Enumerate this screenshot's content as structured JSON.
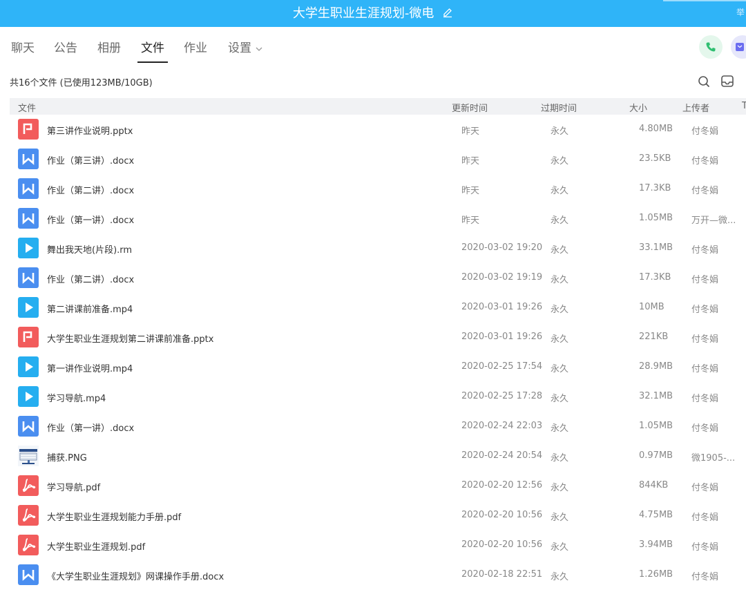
{
  "window": {
    "title": "大学生职业生涯规划-微电",
    "corner_text": "举"
  },
  "tabs": [
    {
      "label": "聊天"
    },
    {
      "label": "公告"
    },
    {
      "label": "相册"
    },
    {
      "label": "文件",
      "active": true
    },
    {
      "label": "作业"
    },
    {
      "label": "设置"
    }
  ],
  "summary": "共16个文件 (已使用123MB/10GB)",
  "table": {
    "headers": {
      "file": "文件",
      "updated": "更新时间",
      "expire": "过期时间",
      "size": "大小",
      "uploader": "上传者",
      "extra": "T"
    },
    "rows": [
      {
        "icon": "ppt-icon",
        "name": "第三讲作业说明.pptx",
        "updated": "昨天",
        "expire": "永久",
        "size": "4.80MB",
        "uploader": "付冬娟"
      },
      {
        "icon": "word-icon",
        "name": "作业（第三讲）.docx",
        "updated": "昨天",
        "expire": "永久",
        "size": "23.5KB",
        "uploader": "付冬娟"
      },
      {
        "icon": "word-icon",
        "name": "作业（第二讲）.docx",
        "updated": "昨天",
        "expire": "永久",
        "size": "17.3KB",
        "uploader": "付冬娟"
      },
      {
        "icon": "word-icon",
        "name": "作业（第一讲）.docx",
        "updated": "昨天",
        "expire": "永久",
        "size": "1.05MB",
        "uploader": "万开—微..."
      },
      {
        "icon": "video-icon",
        "name": "舞出我天地(片段).rm",
        "updated": "2020-03-02 19:20",
        "expire": "永久",
        "size": "33.1MB",
        "uploader": "付冬娟"
      },
      {
        "icon": "word-icon",
        "name": "作业（第二讲）.docx",
        "updated": "2020-03-02 19:19",
        "expire": "永久",
        "size": "17.3KB",
        "uploader": "付冬娟"
      },
      {
        "icon": "video-icon",
        "name": "第二讲课前准备.mp4",
        "updated": "2020-03-01 19:26",
        "expire": "永久",
        "size": "10MB",
        "uploader": "付冬娟"
      },
      {
        "icon": "ppt-icon",
        "name": "大学生职业生涯规划第二讲课前准备.pptx",
        "updated": "2020-03-01 19:26",
        "expire": "永久",
        "size": "221KB",
        "uploader": "付冬娟"
      },
      {
        "icon": "video-icon",
        "name": "第一讲作业说明.mp4",
        "updated": "2020-02-25 17:54",
        "expire": "永久",
        "size": "28.9MB",
        "uploader": "付冬娟"
      },
      {
        "icon": "video-icon",
        "name": "学习导航.mp4",
        "updated": "2020-02-25 17:28",
        "expire": "永久",
        "size": "32.1MB",
        "uploader": "付冬娟"
      },
      {
        "icon": "word-icon",
        "name": "作业（第一讲）.docx",
        "updated": "2020-02-24 22:03",
        "expire": "永久",
        "size": "1.05MB",
        "uploader": "付冬娟"
      },
      {
        "icon": "image-thumbnail-icon",
        "name": "捕获.PNG",
        "updated": "2020-02-24 20:54",
        "expire": "永久",
        "size": "0.97MB",
        "uploader": "微1905-..."
      },
      {
        "icon": "pdf-icon",
        "name": "学习导航.pdf",
        "updated": "2020-02-20 12:56",
        "expire": "永久",
        "size": "844KB",
        "uploader": "付冬娟"
      },
      {
        "icon": "pdf-icon",
        "name": "大学生职业生涯规划能力手册.pdf",
        "updated": "2020-02-20 10:56",
        "expire": "永久",
        "size": "4.75MB",
        "uploader": "付冬娟"
      },
      {
        "icon": "pdf-icon",
        "name": "大学生职业生涯规划.pdf",
        "updated": "2020-02-20 10:56",
        "expire": "永久",
        "size": "3.94MB",
        "uploader": "付冬娟"
      },
      {
        "icon": "word-icon",
        "name": "《大学生职业生涯规划》网课操作手册.docx",
        "updated": "2020-02-18 22:51",
        "expire": "永久",
        "size": "1.26MB",
        "uploader": "付冬娟"
      }
    ]
  },
  "colors": {
    "titlebar": "#2fb4f8",
    "ppt": "#f25c5c",
    "word": "#4a8ef0",
    "video": "#25aef0",
    "pdf": "#f25c5c",
    "call": "#2fbf71",
    "video_call": "#6b6df0"
  }
}
